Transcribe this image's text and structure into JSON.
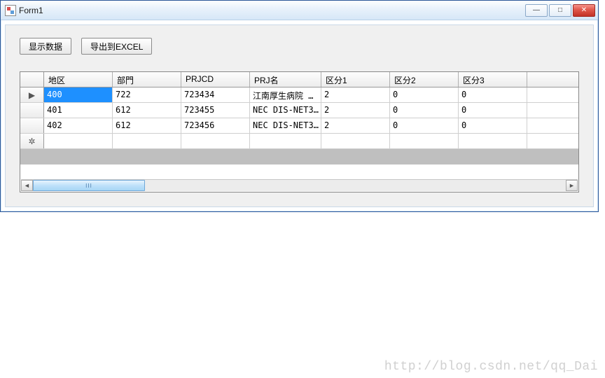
{
  "window": {
    "title": "Form1"
  },
  "toolbar": {
    "show_data_label": "显示数据",
    "export_excel_label": "导出到EXCEL"
  },
  "grid": {
    "headers": {
      "region": "地区",
      "dept": "部門",
      "prjcd": "PRJCD",
      "prjname": "PRJ名",
      "k1": "区分1",
      "k2": "区分2",
      "k3": "区分3"
    },
    "rows": [
      {
        "region": "400",
        "dept": "722",
        "prjcd": "723434",
        "prjname": "江南厚生病院 …",
        "k1": "2",
        "k2": "0",
        "k3": "0",
        "selected": true,
        "current": true
      },
      {
        "region": "401",
        "dept": "612",
        "prjcd": "723455",
        "prjname": "NEC DIS-NET3…",
        "k1": "2",
        "k2": "0",
        "k3": "0"
      },
      {
        "region": "402",
        "dept": "612",
        "prjcd": "723456",
        "prjname": "NEC DIS-NET3…",
        "k1": "2",
        "k2": "0",
        "k3": "0"
      }
    ],
    "row_indicator_current": "▶",
    "row_indicator_new": "✲"
  },
  "watermark": "http://blog.csdn.net/qq_Dai"
}
